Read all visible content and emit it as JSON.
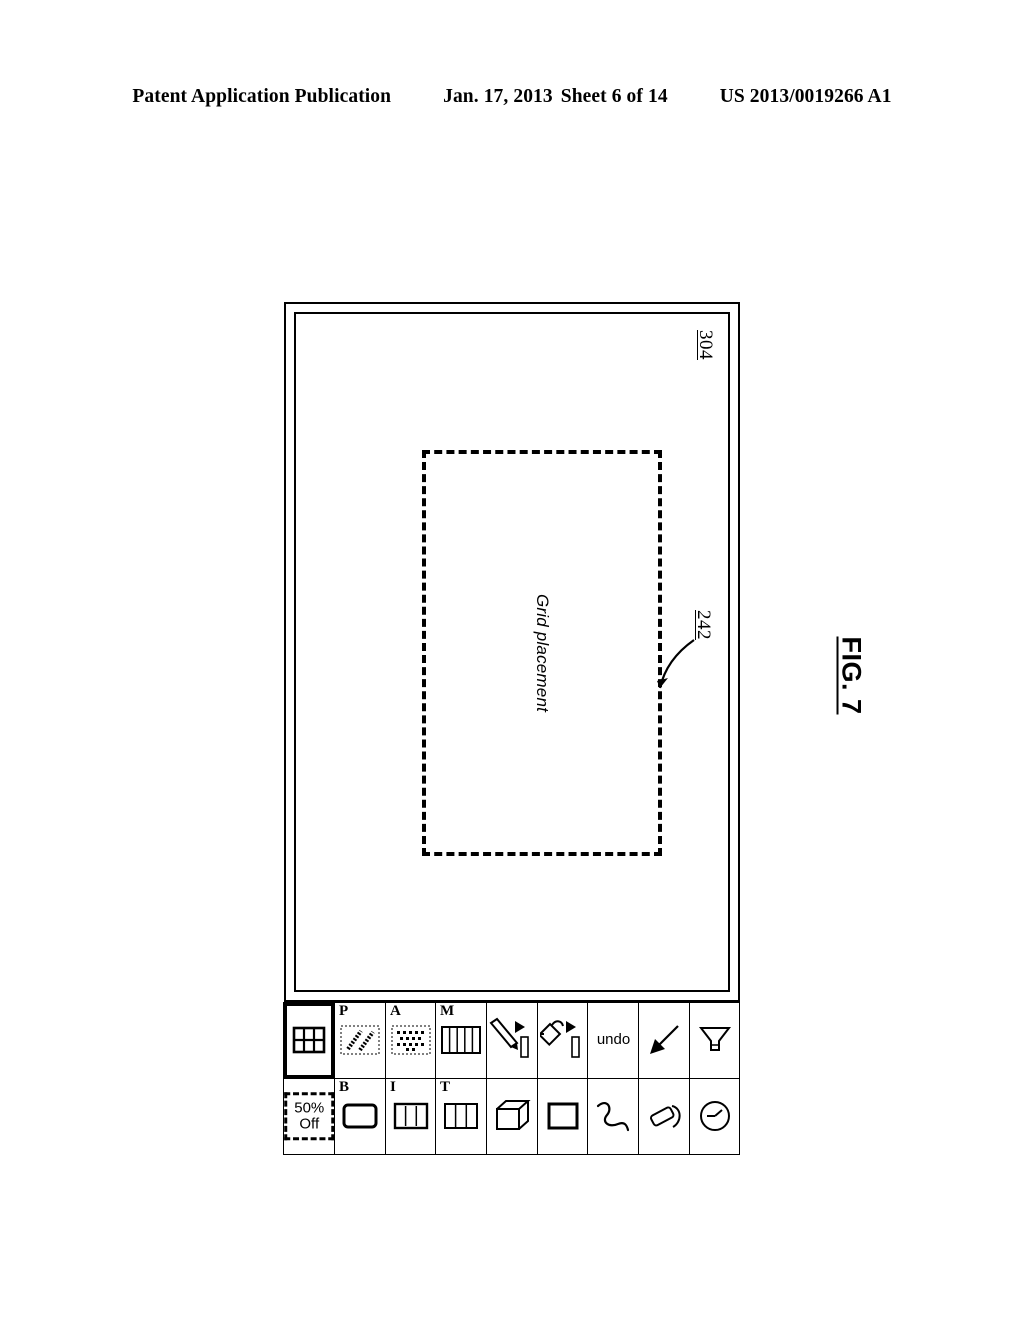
{
  "header": {
    "publication": "Patent Application Publication",
    "date": "Jan. 17, 2013",
    "sheet": "Sheet 6 of 14",
    "number": "US 2013/0019266 A1"
  },
  "figure": {
    "label": "FIG. 7",
    "device_ref": "304",
    "callout_ref": "242",
    "placement_label": "Grid placement"
  },
  "toolbar": {
    "rows": [
      {
        "left": {
          "name": "filter-funnel-icon",
          "icon": "funnel",
          "letter": "",
          "label": ""
        },
        "right": {
          "name": "clock-icon",
          "icon": "clock",
          "letter": "",
          "label": ""
        }
      },
      {
        "left": {
          "name": "arrow-pointer-icon",
          "icon": "arrow",
          "letter": "",
          "label": ""
        },
        "right": {
          "name": "eraser-icon",
          "icon": "eraser",
          "letter": "",
          "label": ""
        }
      },
      {
        "left": {
          "name": "undo-button",
          "icon": "text",
          "letter": "",
          "label": "undo"
        },
        "right": {
          "name": "freehand-curve-icon",
          "icon": "squiggle",
          "letter": "",
          "label": ""
        }
      },
      {
        "left": {
          "name": "paint-bucket-icon",
          "icon": "bucket",
          "letter": "",
          "label": ""
        },
        "right": {
          "name": "square-shape-icon",
          "icon": "square",
          "letter": "",
          "label": ""
        }
      },
      {
        "left": {
          "name": "pencil-icon",
          "icon": "pencil",
          "letter": "",
          "label": ""
        },
        "right": {
          "name": "cube-shape-icon",
          "icon": "cube",
          "letter": "",
          "label": ""
        }
      },
      {
        "left": {
          "name": "layout-columns-m-icon",
          "icon": "cols5",
          "letter": "M",
          "label": ""
        },
        "right": {
          "name": "layout-columns-t-icon",
          "icon": "cols3",
          "letter": "T",
          "label": ""
        }
      },
      {
        "left": {
          "name": "halftone-texture-a-icon",
          "icon": "halftone-block",
          "letter": "A",
          "label": ""
        },
        "right": {
          "name": "layout-columns-i-icon",
          "icon": "cols3-dashed",
          "letter": "I",
          "label": ""
        }
      },
      {
        "left": {
          "name": "diagonal-strokes-p-icon",
          "icon": "strokes",
          "letter": "P",
          "label": ""
        },
        "right": {
          "name": "rounded-rect-b-icon",
          "icon": "roundrect",
          "letter": "B",
          "label": ""
        }
      },
      {
        "left": {
          "name": "grid-tool-button",
          "icon": "grid",
          "letter": "",
          "label": "",
          "selected": true
        },
        "right": {
          "name": "discount-badge",
          "icon": "discount",
          "letter": "",
          "label": "",
          "discount_line1": "50%",
          "discount_line2": "Off"
        }
      }
    ]
  }
}
